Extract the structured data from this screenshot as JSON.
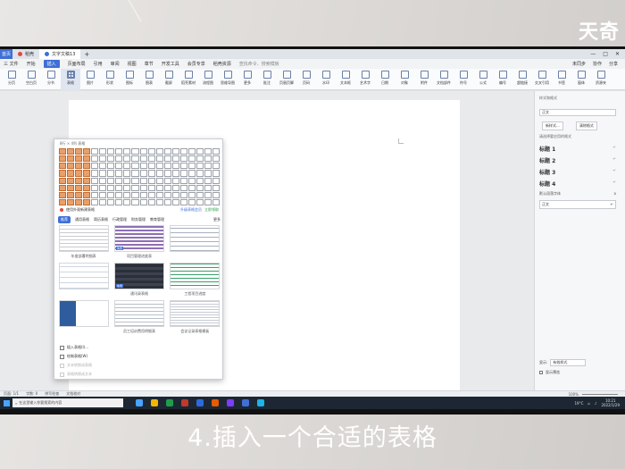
{
  "brand": "天奇",
  "caption": "4.插入一个合适的表格",
  "tabs": {
    "home": "首页",
    "straw": "稻壳",
    "doc": "文字文稿13",
    "plus": "+"
  },
  "window_controls": [
    "—",
    "□",
    "✕"
  ],
  "menu": {
    "file": "三 文件",
    "items": [
      "开始",
      "插入",
      "页面布局",
      "引用",
      "审阅",
      "视图",
      "章节",
      "开发工具",
      "会员专享",
      "稻壳资源"
    ],
    "active": "插入",
    "search": "查找命令、搜索模板",
    "right": [
      "未同步",
      "协作",
      "分享"
    ]
  },
  "ribbon": [
    "分页",
    "空白页",
    "分节",
    "表格",
    "图片",
    "形状",
    "图标",
    "图表",
    "截屏",
    "稻壳素材",
    "流程图",
    "思维导图",
    "更多",
    "批注",
    "页眉页脚",
    "页码",
    "水印",
    "文本框",
    "艺术字",
    "日期",
    "对象",
    "附件",
    "文档部件",
    "符号",
    "公式",
    "编号",
    "超链接",
    "交叉引用",
    "书签",
    "窗体",
    "资源夹"
  ],
  "table_dropdown": {
    "header": "8行 × 4列 表格",
    "grid_cols": 20,
    "grid_rows": 8,
    "selected_cols": 4,
    "selected_rows": 8,
    "hint": "使用外观新建表格",
    "upgrade": "升级表格会员",
    "tip": "立即领取",
    "categories": [
      "推荐",
      "通用表格",
      "简历表格",
      "行政管理",
      "财务管理",
      "教育管理",
      "更多"
    ],
    "active_category": "推荐",
    "templates": [
      {
        "label": "年度部署明细表",
        "tag": ""
      },
      {
        "label": "项目管理进度表",
        "tag": "免费"
      },
      {
        "label": "",
        "tag": ""
      },
      {
        "label": "",
        "tag": ""
      },
      {
        "label": "通讯录表格",
        "tag": "免费"
      },
      {
        "label": "工程项目进度",
        "tag": ""
      },
      {
        "label": "",
        "tag": ""
      },
      {
        "label": "员工培训费用明细表",
        "tag": ""
      },
      {
        "label": "会议记录表格模板",
        "tag": ""
      }
    ],
    "menu_items": [
      {
        "label": "插入表格(I)...",
        "disabled": false
      },
      {
        "label": "绘制表格(W)",
        "disabled": false
      },
      {
        "label": "文本转换成表格",
        "disabled": true
      },
      {
        "label": "表格转换成文本",
        "disabled": true
      }
    ]
  },
  "style_pane": {
    "title": "样式和格式",
    "current": "正文",
    "btn_new": "新样式...",
    "btn_clear": "清除格式",
    "label": "请选择要应用的格式",
    "styles": [
      "标题 1",
      "标题 2",
      "标题 3",
      "标题 4"
    ],
    "default_font": "默认段落字体",
    "selected": "正文",
    "show_label": "显示:",
    "show_value": "有效样式",
    "preview_label": "显示预览"
  },
  "statusbar": {
    "page": "页面: 1/1",
    "words": "字数: 0",
    "spell": "拼写检查",
    "compat": "文档校对",
    "zoom": "100%"
  },
  "taskbar": {
    "search": "在这里输入你要搜索的内容",
    "temp": "19°C",
    "time": "10:21",
    "date": "2022/1/29",
    "app_colors": [
      "#4aa3ff",
      "#f2b705",
      "#1e9e4a",
      "#c0392b",
      "#2c6bdc",
      "#e65c00",
      "#7d3cff",
      "#3f6fd6",
      "#1db4e8"
    ]
  }
}
